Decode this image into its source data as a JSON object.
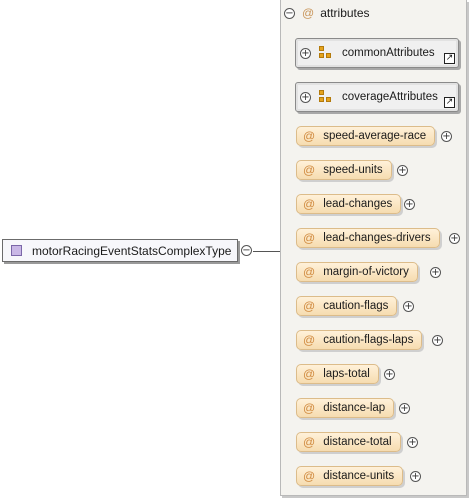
{
  "root_type": {
    "label": "motorRacingEventStatsComplexType",
    "icon": "complex-type-icon"
  },
  "attributes_group": {
    "label": "attributes",
    "at_symbol": "@",
    "collapse_symbol": "−",
    "expand_symbol": "+",
    "link_symbol": "↗",
    "refs": [
      {
        "label": "commonAttributes"
      },
      {
        "label": "coverageAttributes"
      }
    ],
    "items": [
      {
        "label": "speed-average-race"
      },
      {
        "label": "speed-units"
      },
      {
        "label": "lead-changes"
      },
      {
        "label": "lead-changes-drivers"
      },
      {
        "label": "margin-of-victory"
      },
      {
        "label": "caution-flags"
      },
      {
        "label": "caution-flags-laps"
      },
      {
        "label": "laps-total"
      },
      {
        "label": "distance-lap"
      },
      {
        "label": "distance-total"
      },
      {
        "label": "distance-units"
      }
    ]
  },
  "colors": {
    "type_icon": "#c9b7e6",
    "attribute_fill": "#fbe7c4",
    "attribute_at": "#d08a3f",
    "group_ref_icon": "#e5a31d"
  }
}
